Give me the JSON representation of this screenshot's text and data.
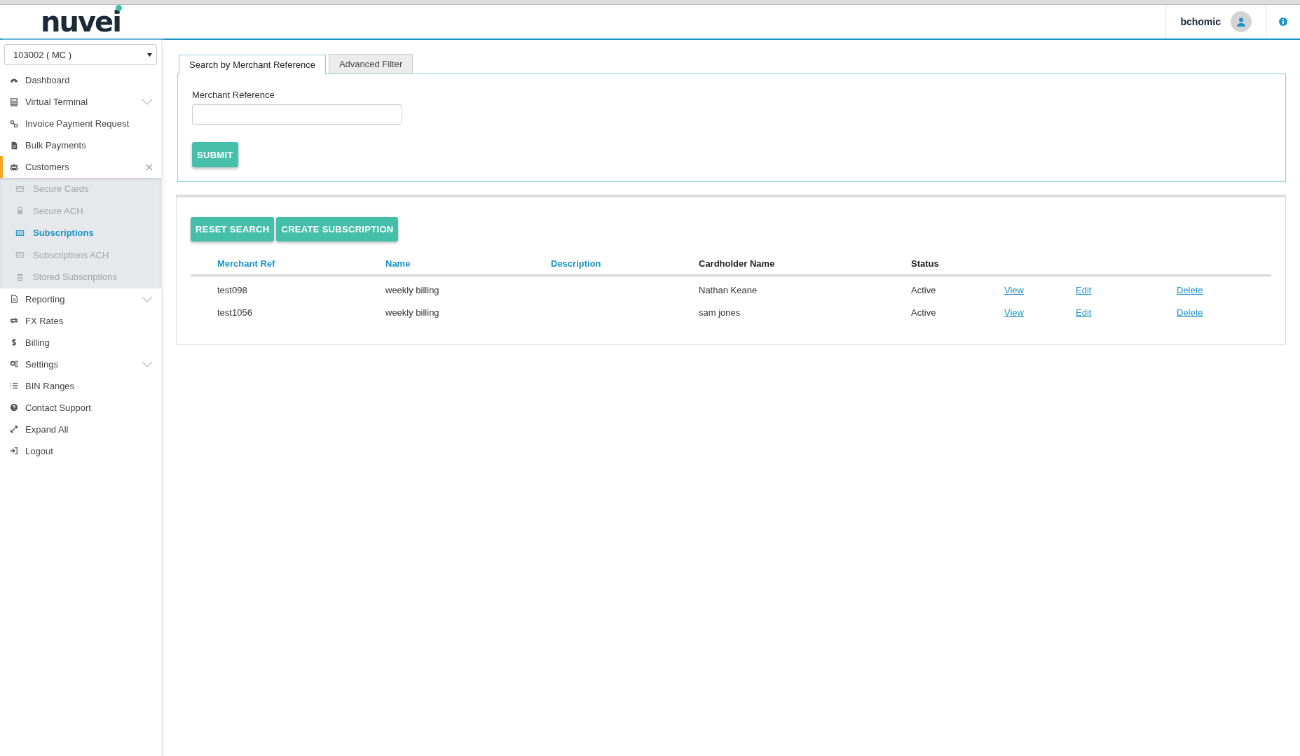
{
  "header": {
    "logo": "nuvei",
    "username": "bchomic"
  },
  "sidebar": {
    "account_select": "103002 ( MC )",
    "items": [
      {
        "label": "Dashboard",
        "selected": false
      },
      {
        "label": "Virtual Terminal",
        "selected": false,
        "expanded": false
      },
      {
        "label": "Invoice Payment Request",
        "selected": false
      },
      {
        "label": "Bulk Payments",
        "selected": false
      },
      {
        "label": "Customers",
        "selected": true,
        "expanded": true,
        "children": [
          {
            "label": "Secure Cards",
            "selected": false
          },
          {
            "label": "Secure ACH",
            "selected": false
          },
          {
            "label": "Subscriptions",
            "selected": true
          },
          {
            "label": "Subscriptions ACH",
            "selected": false
          },
          {
            "label": "Stored Subscriptions",
            "selected": false
          }
        ]
      },
      {
        "label": "Reporting",
        "selected": false,
        "expanded": false
      },
      {
        "label": "FX Rates",
        "selected": false
      },
      {
        "label": "Billing",
        "selected": false
      },
      {
        "label": "Settings",
        "selected": false,
        "expanded": false
      },
      {
        "label": "BIN Ranges",
        "selected": false
      },
      {
        "label": "Contact Support",
        "selected": false
      },
      {
        "label": "Expand All",
        "selected": false
      },
      {
        "label": "Logout",
        "selected": false
      }
    ]
  },
  "search": {
    "tabs": [
      {
        "label": "Search by Merchant Reference",
        "selected": true
      },
      {
        "label": "Advanced Filter",
        "selected": false
      }
    ],
    "field_label": "Merchant Reference",
    "submit": "SUBMIT"
  },
  "results": {
    "buttons": [
      "RESET SEARCH",
      "CREATE SUBSCRIPTION"
    ],
    "columns": [
      {
        "label": "Merchant Ref",
        "kind": "sortable"
      },
      {
        "label": "Name",
        "kind": "sortable"
      },
      {
        "label": "Description",
        "kind": "sortable"
      },
      {
        "label": "Cardholder Name",
        "kind": "plain"
      },
      {
        "label": "Status",
        "kind": "plain"
      }
    ],
    "rows": [
      {
        "merchant_ref": "test098",
        "name": "weekly billing",
        "cardholder": "Nathan Keane",
        "status": "Active",
        "actions": [
          "View",
          "Edit",
          "Delete"
        ]
      },
      {
        "merchant_ref": "test1056",
        "name": "weekly billing",
        "cardholder": "sam jones",
        "status": "Active",
        "actions": [
          "View",
          "Edit",
          "Delete"
        ]
      }
    ]
  }
}
